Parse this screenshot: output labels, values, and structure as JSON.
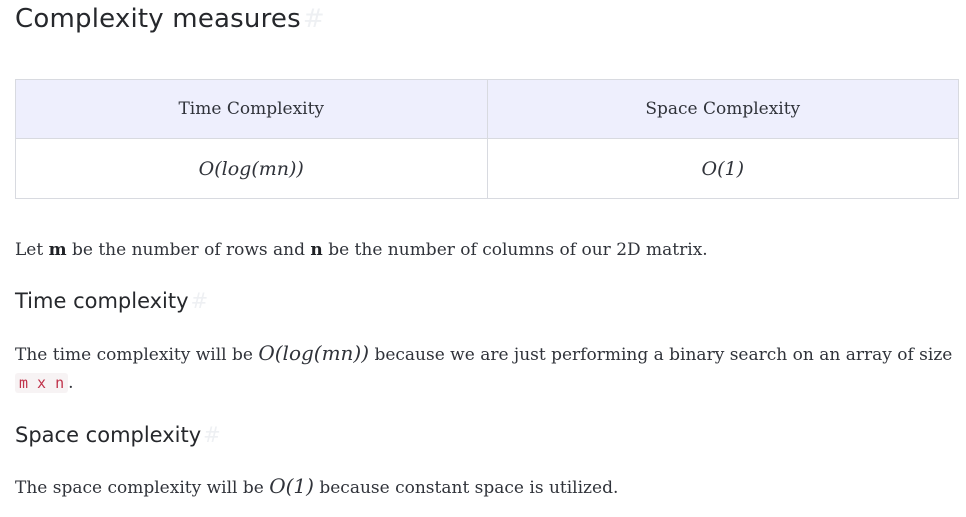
{
  "heading": "Complexity measures",
  "anchor_symbol": "#",
  "table": {
    "headers": [
      "Time Complexity",
      "Space Complexity"
    ],
    "row": [
      "O(log(mn))",
      "O(1)"
    ]
  },
  "intro": {
    "part1": "Let ",
    "m": "m",
    "part2": " be the number of rows and ",
    "n": "n",
    "part3": " be the number of columns of our 2D matrix."
  },
  "time_section": {
    "heading": "Time complexity",
    "line1_prefix": "The time complexity will be ",
    "line1_math": "O(log(mn))",
    "line1_suffix": " because we are just performing a binary search on an array of size",
    "code": "m x n",
    "after_code": "."
  },
  "space_section": {
    "heading": "Space complexity",
    "prefix": "The space complexity will be ",
    "math": "O(1)",
    "suffix": " because constant space is utilized."
  }
}
